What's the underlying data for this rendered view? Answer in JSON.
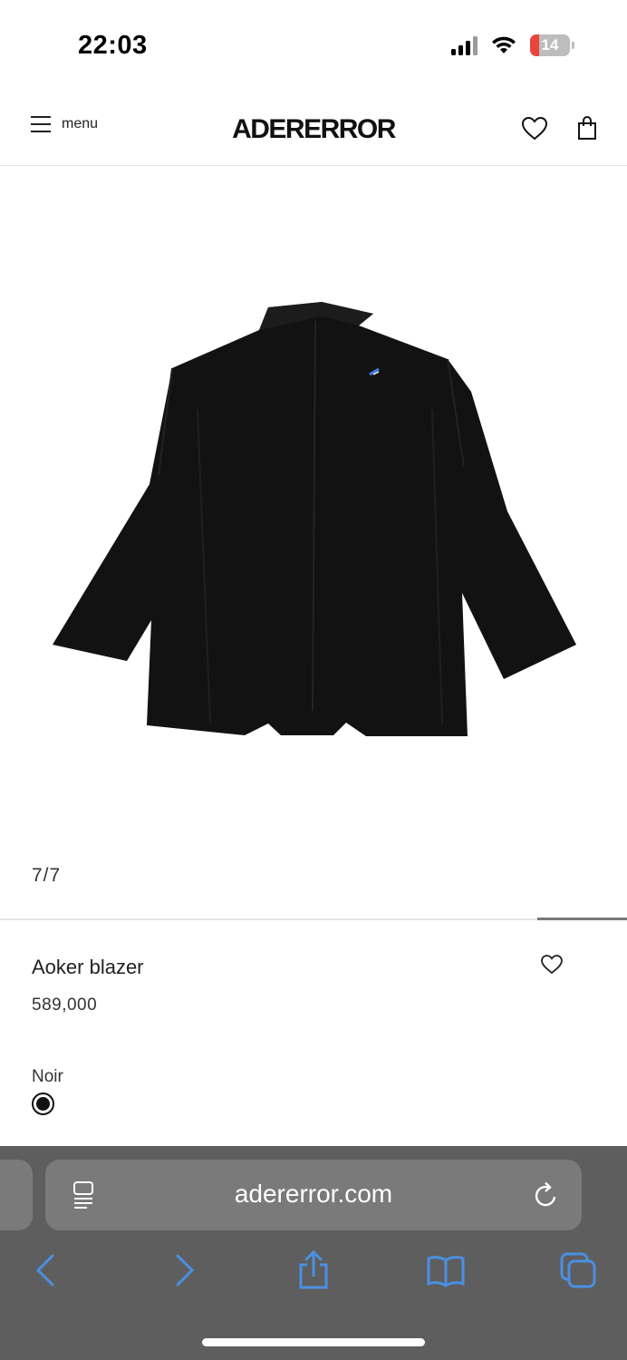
{
  "status_bar": {
    "time": "22:03",
    "battery_level": "14",
    "icons": [
      "signal-icon",
      "wifi-icon",
      "battery-icon"
    ],
    "battery_color": "#e8453c"
  },
  "header": {
    "menu_label": "menu",
    "logo_text": "ADERERROR",
    "icons": [
      "menu-icon",
      "heart-icon",
      "bag-icon"
    ]
  },
  "gallery": {
    "counter": "7/7",
    "progress_fraction": 1.0
  },
  "product": {
    "name": "Aoker blazer",
    "price": "589,000",
    "color_name": "Noir",
    "selected_color": "#111111"
  },
  "browser": {
    "url": "adererror.com",
    "icons": [
      "reader-icon",
      "reload-icon",
      "back-icon",
      "forward-icon",
      "share-icon",
      "bookmarks-icon",
      "tabs-icon"
    ],
    "accent": "#4a90e2"
  }
}
